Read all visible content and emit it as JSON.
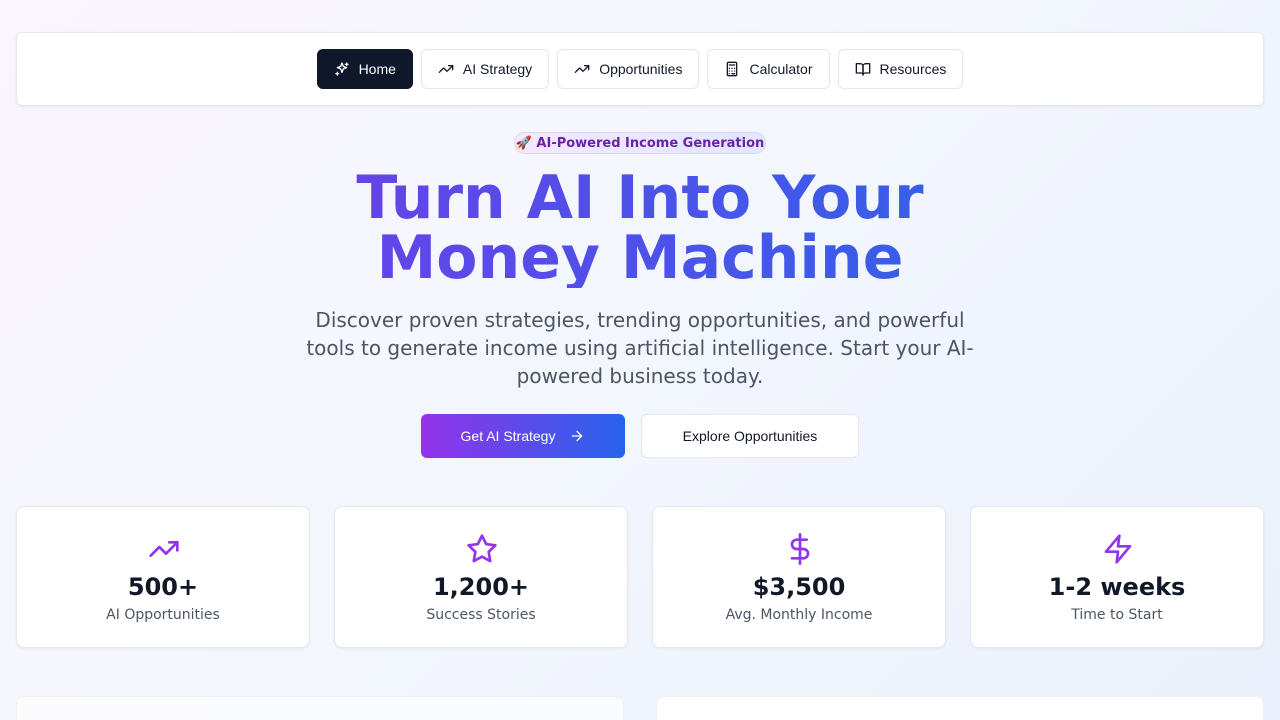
{
  "nav": {
    "items": [
      {
        "label": "Home",
        "icon": "sparkles-icon",
        "active": true
      },
      {
        "label": "AI Strategy",
        "icon": "trending-up-icon"
      },
      {
        "label": "Opportunities",
        "icon": "trending-up-icon"
      },
      {
        "label": "Calculator",
        "icon": "calculator-icon"
      },
      {
        "label": "Resources",
        "icon": "book-open-icon"
      }
    ]
  },
  "hero": {
    "badge": "🚀 AI-Powered Income Generation",
    "title_line1": "Turn AI Into Your",
    "title_line2": "Money Machine",
    "subtitle": "Discover proven strategies, trending opportunities, and powerful tools to generate income using artificial intelligence. Start your AI-powered business today.",
    "primary_cta": "Get AI Strategy",
    "secondary_cta": "Explore Opportunities"
  },
  "stats": [
    {
      "value": "500+",
      "label": "AI Opportunities",
      "icon": "trending-up-icon"
    },
    {
      "value": "1,200+",
      "label": "Success Stories",
      "icon": "star-icon"
    },
    {
      "value": "$3,500",
      "label": "Avg. Monthly Income",
      "icon": "dollar-sign-icon"
    },
    {
      "value": "1-2 weeks",
      "label": "Time to Start",
      "icon": "zap-icon"
    }
  ],
  "colors": {
    "accent_purple": "#9333ea",
    "accent_blue": "#2563eb",
    "nav_active": "#0f172a"
  }
}
